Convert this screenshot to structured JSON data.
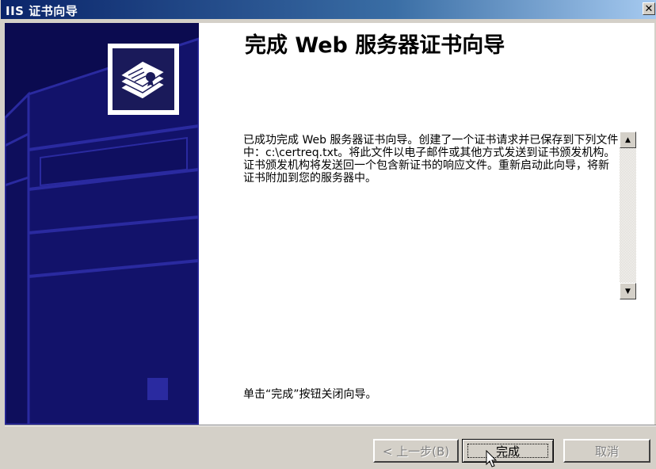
{
  "window": {
    "title": "IIS 证书向导",
    "close_glyph": "✕"
  },
  "content": {
    "heading": "完成 Web 服务器证书向导",
    "body": "已成功完成 Web 服务器证书向导。创建了一个证书请求并已保存到下列文件中：c:\\certreq.txt。将此文件以电子邮件或其他方式发送到证书颁发机构。证书颁发机构将发送回一个包含新证书的响应文件。重新启动此向导，将新证书附加到您的服务器中。",
    "click_hint": "单击“完成”按钮关闭向导。"
  },
  "scrollbar": {
    "up_glyph": "▲",
    "down_glyph": "▼"
  },
  "buttons": {
    "back": "< 上一步(B)",
    "finish": "完成",
    "cancel": "取消"
  },
  "icons": {
    "banner": "certificate-stack-icon",
    "cursor": "mouse-pointer-icon"
  }
}
